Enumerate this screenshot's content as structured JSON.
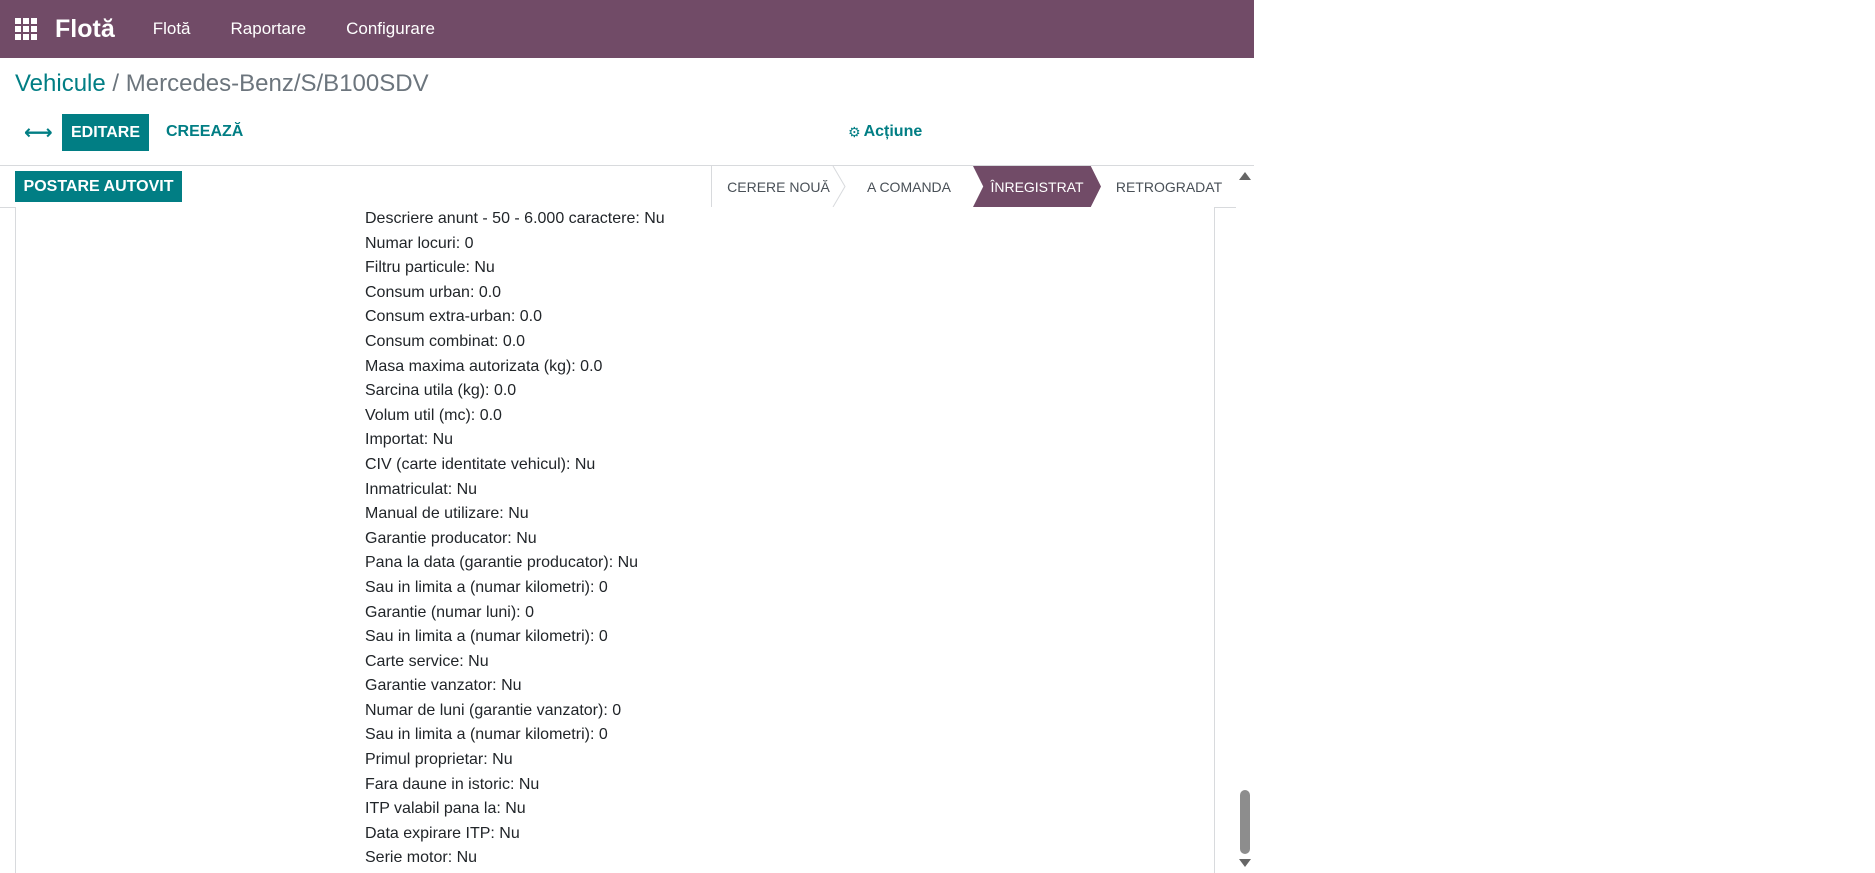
{
  "navbar": {
    "app_title": "Flotă",
    "menu": [
      "Flotă",
      "Raportare",
      "Configurare"
    ]
  },
  "breadcrumb": {
    "parent": "Vehicule",
    "separator": " / ",
    "current": "Mercedes-Benz/S/B100SDV"
  },
  "toolbar": {
    "toggle_icon": "⟷",
    "edit_label": "EDITARE",
    "create_label": "CREEAZĂ",
    "action_icon": "gear-icon",
    "action_label": "Acțiune"
  },
  "statusbar": {
    "post_button": "POSTARE AUTOVIT",
    "stages": [
      "CERERE NOUĂ",
      "A COMANDA",
      "ÎNREGISTRAT",
      "RETROGRADAT"
    ],
    "active_stage": "ÎNREGISTRAT"
  },
  "description_lines": [
    "Descriere anunt - 50 - 6.000 caractere: Nu",
    "Numar locuri: 0",
    "Filtru particule: Nu",
    "Consum urban: 0.0",
    "Consum extra-urban: 0.0",
    "Consum combinat: 0.0",
    "Masa maxima autorizata (kg): 0.0",
    "Sarcina utila (kg): 0.0",
    "Volum util (mc): 0.0",
    "Importat: Nu",
    "CIV (carte identitate vehicul): Nu",
    "Inmatriculat: Nu",
    "Manual de utilizare: Nu",
    "Garantie producator: Nu",
    "Pana la data (garantie producator): Nu",
    "Sau in limita a (numar kilometri): 0",
    "Garantie (numar luni): 0",
    "Sau in limita a (numar kilometri): 0",
    "Carte service: Nu",
    "Garantie vanzator: Nu",
    "Numar de luni (garantie vanzator): 0",
    "Sau in limita a (numar kilometri): 0",
    "Primul proprietar: Nu",
    "Fara daune in istoric: Nu",
    "ITP valabil pana la: Nu",
    "Data expirare ITP: Nu",
    "Serie motor: Nu"
  ],
  "colors": {
    "navbar": "#714B67",
    "primary": "#017e84"
  }
}
